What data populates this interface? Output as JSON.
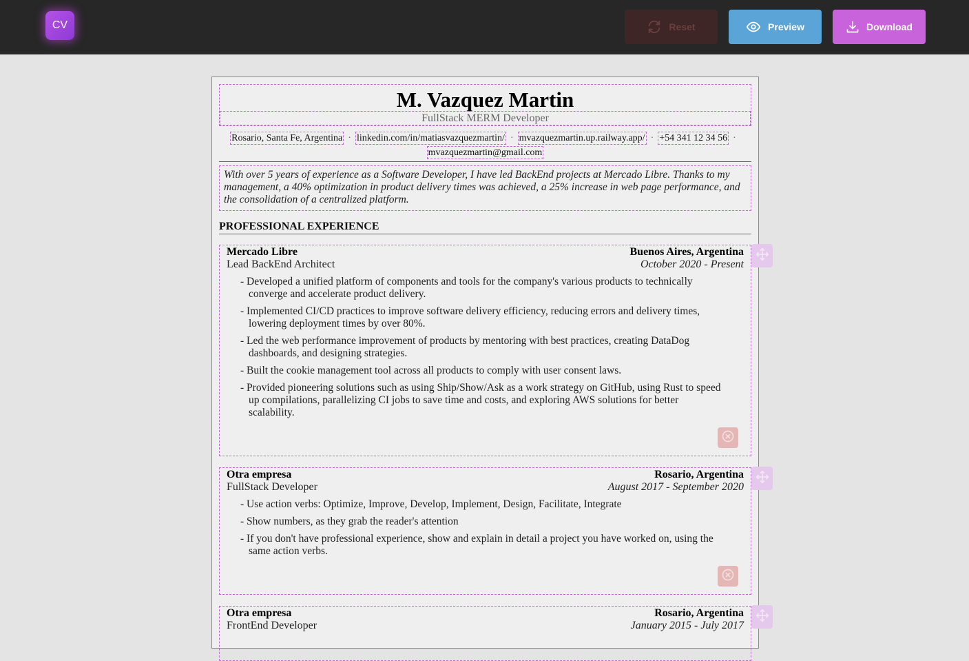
{
  "toolbar": {
    "logo_text": "CV",
    "reset_label": "Reset",
    "preview_label": "Preview",
    "download_label": "Download",
    "colors": {
      "reset": "#3e2626",
      "preview": "#5ba4d8",
      "download": "#c963dc"
    },
    "icons": {
      "reset": "refresh-icon",
      "preview": "eye-icon",
      "download": "download-icon"
    }
  },
  "cv": {
    "name": "M. Vazquez Martin",
    "title": "FullStack MERM Developer",
    "contacts": [
      "Rosario, Santa Fe, Argentina",
      "linkedin.com/in/matiasvazquezmartin/",
      "mvazquezmartin.up.railway.app/",
      "+54 341 12 34 56",
      "mvazquezmartin@gmail.com"
    ],
    "summary": "With over 5 years of experience as a Software Developer, I have led BackEnd projects at Mercado Libre. Thanks to my management, a 40% optimization in product delivery times was achieved, a 25% increase in web page performance, and the consolidation of a centralized platform.",
    "experience_title": "PROFESSIONAL EXPERIENCE",
    "jobs": [
      {
        "company": "Mercado Libre",
        "role": "Lead BackEnd Architect",
        "location": "Buenos Aires, Argentina",
        "dates": "October 2020 - Present",
        "bullets": [
          "Developed a unified platform of components and tools for the company's various products to technically converge and accelerate product delivery.",
          "Implemented CI/CD practices to improve software delivery efficiency, reducing errors and delivery times, lowering deployment times by over 80%.",
          "Led the web performance improvement of products by mentoring with best practices, creating DataDog dashboards, and designing strategies.",
          "Built the cookie management tool across all products to comply with user consent laws.",
          "Provided pioneering solutions such as using Ship/Show/Ask as a work strategy on GitHub, using Rust to speed up compilations, parallelizing CI jobs to save time and costs, and exploring AWS solutions for better scalability."
        ]
      },
      {
        "company": "Otra empresa",
        "role": "FullStack Developer",
        "location": "Rosario, Argentina",
        "dates": "August 2017 - September 2020",
        "bullets": [
          "Use action verbs: Optimize, Improve, Develop, Implement, Design, Facilitate, Integrate",
          "Show numbers, as they grab the reader's attention",
          "If you don't have professional experience, show and explain in detail a project you have worked on, using the same action verbs."
        ]
      },
      {
        "company": "Otra empresa",
        "role": "FrontEnd Developer",
        "location": "Rosario, Argentina",
        "dates": "January 2015 - July 2017",
        "bullets": []
      }
    ]
  }
}
